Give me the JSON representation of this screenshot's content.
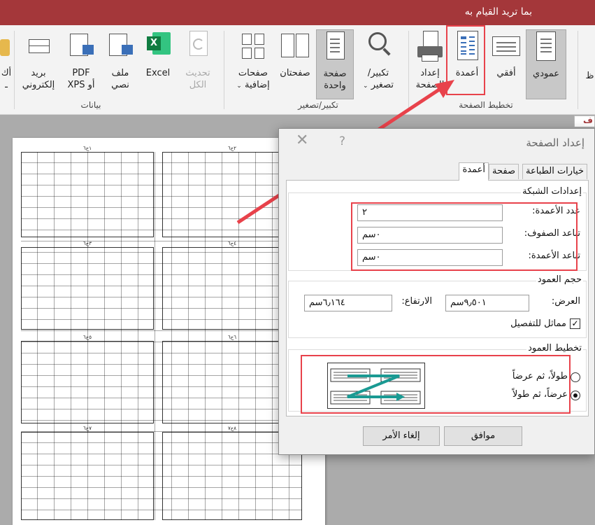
{
  "title_bar": {
    "tell_me": "بما تريد القيام به"
  },
  "ribbon": {
    "buttons": {
      "portrait": "عمودي",
      "landscape": "أفقي",
      "columns": "أعمدة",
      "page_setup_l1": "إعداد",
      "page_setup_l2": "الصفحة",
      "zoom_l1": "تكبير/",
      "zoom_l2": "تصغير",
      "one_page_l1": "صفحة",
      "one_page_l2": "واحدة",
      "two_pages": "صفحتان",
      "more_pages_l1": "صفحات",
      "more_pages_l2": "إضافية",
      "refresh_l1": "تحديث",
      "refresh_l2": "الكل",
      "excel": "Excel",
      "text_file_l1": "ملف",
      "text_file_l2": "نصي",
      "pdf_l1": "PDF",
      "pdf_l2": "أو XPS",
      "email_l1": "بريد",
      "email_l2": "إلكتروني",
      "more_l1": "أك",
      "more_l2": "ـ",
      "edge_left": "ظ"
    },
    "groups": {
      "page_layout": "تخطيط الصفحة",
      "zoom": "تكبير/تصغير",
      "data": "بيانات"
    }
  },
  "document_tab": "ف",
  "sheet": {
    "captions": [
      "١ح٦",
      "٢ح٦",
      "٣ح٦",
      "٤ح٦",
      "٥ح٦",
      "٦ح٦",
      "٧ح٦",
      "٨ح٧"
    ]
  },
  "dialog": {
    "title": "إعداد الصفحة",
    "help": "?",
    "close": "✕",
    "tabs": {
      "print_options": "خيارات الطباعة",
      "page": "صفحة",
      "columns": "أعمدة"
    },
    "grid_settings": {
      "legend": "إعدادات الشبكة",
      "num_columns_label": "عدد الأعمدة:",
      "num_columns_value": "٢",
      "row_spacing_label": "تباعد الصفوف:",
      "row_spacing_value": "٠سم",
      "column_spacing_label": "تباعد الأعمدة:",
      "column_spacing_value": "٠سم"
    },
    "column_size": {
      "legend": "حجم العمود",
      "width_label": "العرض:",
      "width_value": "٩٫٥٠١سم",
      "height_label": "الارتفاع:",
      "height_value": "٦٫١٦٤سم",
      "same_as_detail_label": "مماثل للتفصيل",
      "same_as_detail_checked": true
    },
    "column_layout": {
      "legend": "تخطيط العمود",
      "down_then_across": "طولاً، ثم عرضاً",
      "across_then_down": "عرضاً، ثم طولاً",
      "selected": "across_then_down"
    },
    "buttons": {
      "ok": "موافق",
      "cancel": "إلغاء الأمر"
    }
  },
  "colors": {
    "title_bar": "#a4373a",
    "annotation": "#e8424b",
    "preview_arrow": "#1a9a93"
  }
}
